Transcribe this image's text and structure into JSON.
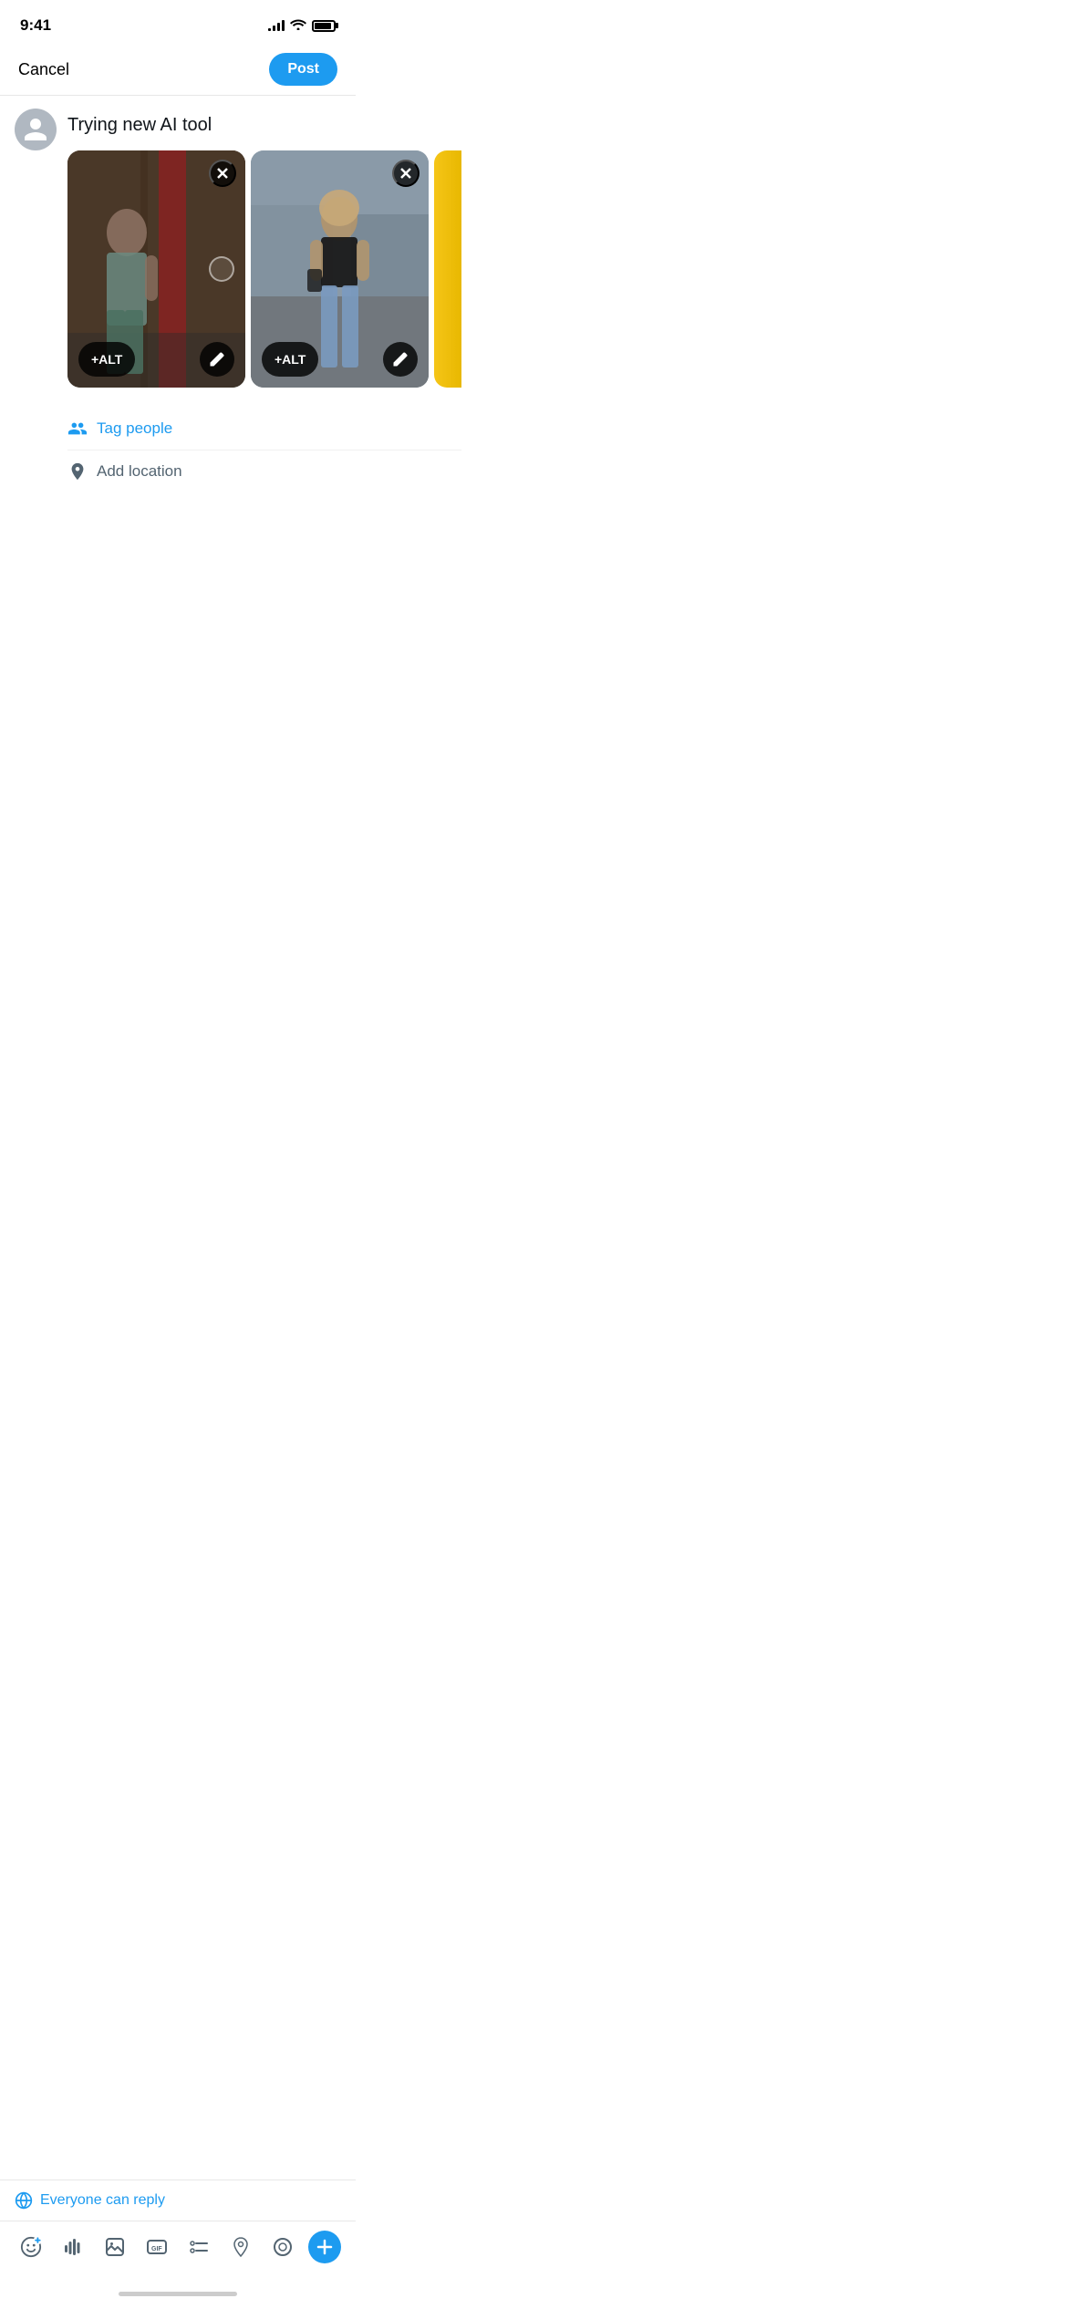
{
  "status": {
    "time": "9:41",
    "signal_bars": [
      3,
      6,
      9,
      12
    ],
    "battery_level": 90
  },
  "header": {
    "cancel_label": "Cancel",
    "post_label": "Post"
  },
  "compose": {
    "text": "Trying new AI tool",
    "images": [
      {
        "id": "img1",
        "alt_label": "+ALT",
        "close_label": "×",
        "description": "Woman at phone booth"
      },
      {
        "id": "img2",
        "alt_label": "+ALT",
        "close_label": "×",
        "description": "Woman on street"
      }
    ]
  },
  "actions": {
    "tag_people": "Tag people",
    "add_location": "Add location"
  },
  "reply_settings": {
    "label": "Everyone can reply"
  },
  "toolbar": {
    "tools": [
      {
        "name": "emoji-plus",
        "label": "Emoji plus"
      },
      {
        "name": "voice",
        "label": "Voice"
      },
      {
        "name": "image",
        "label": "Image"
      },
      {
        "name": "gif",
        "label": "GIF"
      },
      {
        "name": "list",
        "label": "List"
      },
      {
        "name": "location",
        "label": "Location"
      },
      {
        "name": "spaces",
        "label": "Spaces"
      }
    ],
    "add_label": "+"
  }
}
